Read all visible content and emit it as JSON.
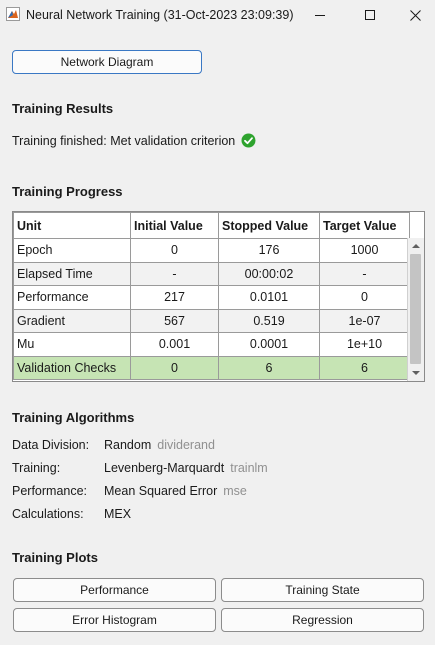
{
  "window": {
    "title": "Neural Network Training (31-Oct-2023 23:09:39)",
    "app_icon": "matlab-icon",
    "controls": [
      "minimize-icon",
      "maximize-icon",
      "close-icon"
    ]
  },
  "network_diagram_button": "Network Diagram",
  "results": {
    "heading": "Training Results",
    "status": "Training finished: Met validation criterion",
    "status_icon": "check-circle-icon",
    "status_color": "#2ea32e"
  },
  "progress": {
    "heading": "Training Progress",
    "columns": [
      "Unit",
      "Initial Value",
      "Stopped Value",
      "Target Value"
    ],
    "rows": [
      {
        "unit": "Epoch",
        "initial": "0",
        "stopped": "176",
        "target": "1000"
      },
      {
        "unit": "Elapsed Time",
        "initial": "-",
        "stopped": "00:00:02",
        "target": "-"
      },
      {
        "unit": "Performance",
        "initial": "217",
        "stopped": "0.0101",
        "target": "0"
      },
      {
        "unit": "Gradient",
        "initial": "567",
        "stopped": "0.519",
        "target": "1e-07"
      },
      {
        "unit": "Mu",
        "initial": "0.001",
        "stopped": "0.0001",
        "target": "1e+10"
      },
      {
        "unit": "Validation Checks",
        "initial": "0",
        "stopped": "6",
        "target": "6"
      }
    ],
    "highlight_color": "#c6e4b4"
  },
  "algorithms": {
    "heading": "Training Algorithms",
    "items": [
      {
        "label": "Data Division:",
        "value": "Random",
        "func": "dividerand"
      },
      {
        "label": "Training:",
        "value": "Levenberg-Marquardt",
        "func": "trainlm"
      },
      {
        "label": "Performance:",
        "value": "Mean Squared Error",
        "func": "mse"
      },
      {
        "label": "Calculations:",
        "value": "MEX",
        "func": ""
      }
    ]
  },
  "plots": {
    "heading": "Training Plots",
    "buttons": [
      "Performance",
      "Training State",
      "Error Histogram",
      "Regression"
    ]
  }
}
